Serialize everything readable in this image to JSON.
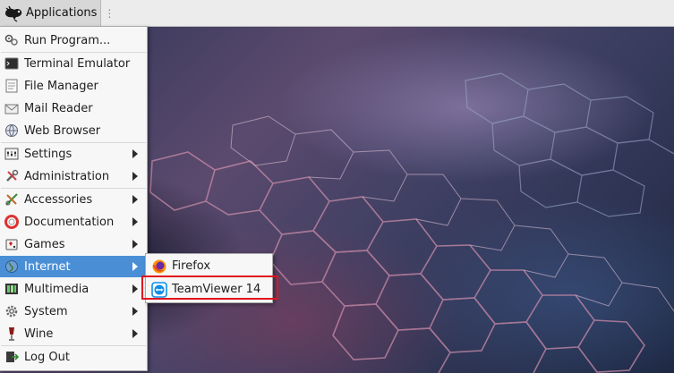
{
  "panel": {
    "app_menu_label": "Applications",
    "app_menu_icon": "xfce-mouse-icon",
    "handle_glyph": "⋮"
  },
  "menu": {
    "items": [
      {
        "label": "Run Program...",
        "icon": "run-program-icon",
        "submenu": false
      },
      {
        "label": "Terminal Emulator",
        "icon": "terminal-icon",
        "submenu": false
      },
      {
        "label": "File Manager",
        "icon": "file-manager-icon",
        "submenu": false
      },
      {
        "label": "Mail Reader",
        "icon": "mail-icon",
        "submenu": false
      },
      {
        "label": "Web Browser",
        "icon": "web-browser-icon",
        "submenu": false
      },
      {
        "label": "Settings",
        "icon": "settings-icon",
        "submenu": true
      },
      {
        "label": "Administration",
        "icon": "administration-icon",
        "submenu": true
      },
      {
        "label": "Accessories",
        "icon": "accessories-icon",
        "submenu": true
      },
      {
        "label": "Documentation",
        "icon": "documentation-icon",
        "submenu": true
      },
      {
        "label": "Games",
        "icon": "games-icon",
        "submenu": true
      },
      {
        "label": "Internet",
        "icon": "internet-icon",
        "submenu": true,
        "active": true
      },
      {
        "label": "Multimedia",
        "icon": "multimedia-icon",
        "submenu": true
      },
      {
        "label": "System",
        "icon": "system-icon",
        "submenu": true
      },
      {
        "label": "Wine",
        "icon": "wine-icon",
        "submenu": true
      },
      {
        "label": "Log Out",
        "icon": "log-out-icon",
        "submenu": false
      }
    ]
  },
  "internet_submenu": {
    "items": [
      {
        "label": "Firefox",
        "icon": "firefox-icon"
      },
      {
        "label": "TeamViewer 14",
        "icon": "teamviewer-icon",
        "highlighted": true
      }
    ]
  },
  "colors": {
    "menu_selection": "#4a8fd6",
    "highlight_box": "#e0141e"
  }
}
